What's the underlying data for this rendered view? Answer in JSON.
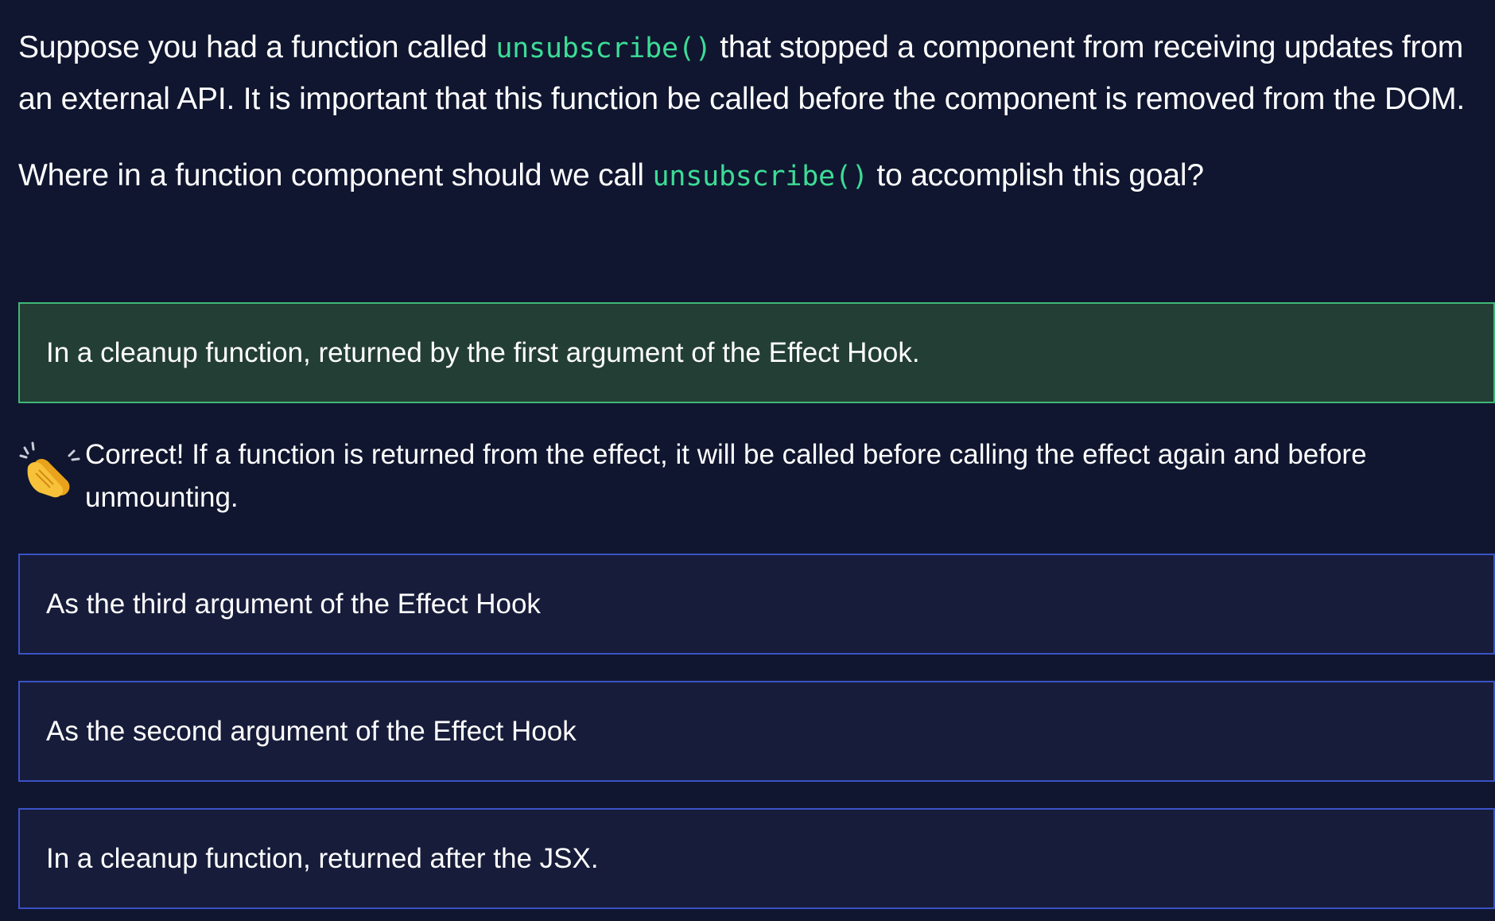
{
  "question": {
    "para1_pre": "Suppose you had a function called ",
    "para1_code": "unsubscribe()",
    "para1_post": " that stopped a component from receiving updates from an external API. It is important that this function be called before the component is removed from the DOM.",
    "para2_pre": "Where in a function component should we call ",
    "para2_code": "unsubscribe()",
    "para2_post": " to accomplish this goal?"
  },
  "options": [
    {
      "text": "In a cleanup function, returned by the first argument of the Effect Hook.",
      "state": "correct"
    },
    {
      "text": "As the third argument of the Effect Hook",
      "state": "default"
    },
    {
      "text": "As the second argument of the Effect Hook",
      "state": "default"
    },
    {
      "text": "In a cleanup function, returned after the JSX.",
      "state": "default"
    }
  ],
  "feedback": {
    "icon": "clapping-hands-icon",
    "text": "Correct! If a function is returned from the effect, it will be called before calling the effect again and before unmounting."
  },
  "colors": {
    "background": "#10162f",
    "code": "#3ddc97",
    "correct_border": "#40b877",
    "correct_fill": "#233e35",
    "option_border": "#3a52c6",
    "option_fill": "#171c3a"
  }
}
